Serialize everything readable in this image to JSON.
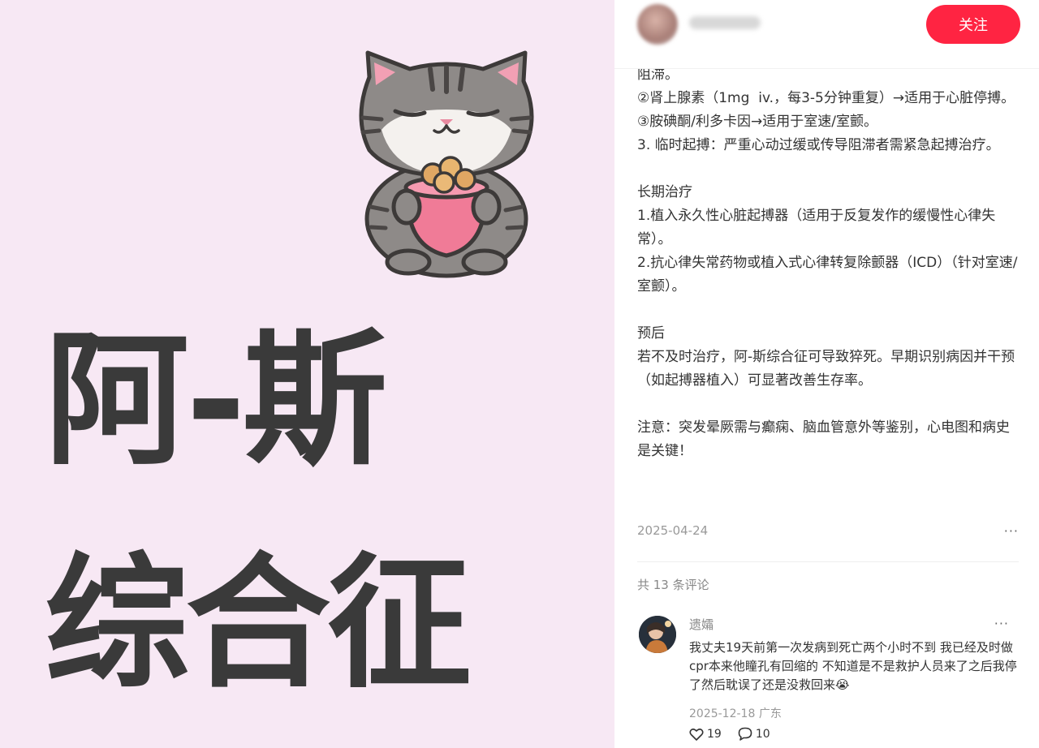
{
  "cover": {
    "title_line1": "阿-斯",
    "title_line2": "综合征"
  },
  "header": {
    "follow_label": "关注"
  },
  "post": {
    "paragraphs": [
      "阻滞。",
      "②肾上腺素（1mg  iv.，每3-5分钟重复）→适用于心脏停搏。",
      "③胺碘酮/利多卡因→适用于室速/室颤。",
      "3. 临时起搏：严重心动过缓或传导阻滞者需紧急起搏治疗。",
      "",
      "长期治疗",
      "1.植入永久性心脏起搏器（适用于反复发作的缓慢性心律失常）。",
      "2.抗心律失常药物或植入式心律转复除颤器（ICD）（针对室速/室颤）。",
      "",
      "预后",
      "若不及时治疗，阿-斯综合征可导致猝死。早期识别病因并干预（如起搏器植入）可显著改善生存率。",
      "",
      "注意：突发晕厥需与癫痫、脑血管意外等鉴别，心电图和病史是关键！"
    ],
    "date": "2025-04-24",
    "more_icon": "···"
  },
  "comments": {
    "count_label": "共 13 条评论",
    "items": [
      {
        "name": "遗孀",
        "text": "我丈夫19天前第一次发病到死亡两个小时不到 我已经及时做cpr本来他瞳孔有回缩的 不知道是不是救护人员来了之后我停了然后耽误了还是没救回来😭",
        "date": "2025-12-18",
        "location": "广东",
        "likes": "19",
        "replies": "10",
        "more_icon": "···"
      }
    ]
  }
}
